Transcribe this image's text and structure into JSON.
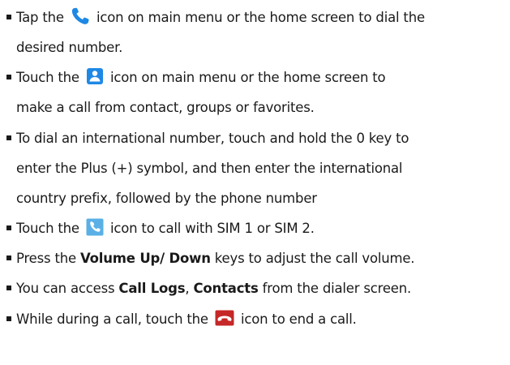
{
  "items": [
    {
      "line1_pre": "Tap the ",
      "line1_post": " icon on main menu or the home screen to dial the",
      "line2": "desired number."
    },
    {
      "line1_pre": "Touch the ",
      "line1_post": " icon on main menu or the home screen to",
      "line2": "make a call from contact, groups or favorites."
    },
    {
      "line1": "To dial an international number, touch and hold the 0 key to",
      "line2": "enter the Plus (+) symbol, and then enter the international",
      "line3": "country prefix, followed by the phone number"
    },
    {
      "line1_pre": "Touch the ",
      "line1_post": " icon to call with SIM 1 or SIM 2."
    },
    {
      "pre": "Press the ",
      "bold": "Volume Up/ Down",
      "post": " keys to adjust the call volume."
    },
    {
      "pre": "You can access ",
      "bold1": "Call Logs",
      "mid": ", ",
      "bold2": "Contacts",
      "post": " from the dialer screen."
    },
    {
      "line1_pre": "While during a call, touch the ",
      "line1_post": " icon to end a call."
    }
  ],
  "icons": {
    "phone_icon": "phone-icon",
    "contacts_icon": "contacts-icon",
    "sim_call_icon": "sim-call-icon",
    "end_call_icon": "end-call-icon"
  },
  "colors": {
    "phone_blue": "#1e88e5",
    "contacts_blue": "#1e88e5",
    "sim_call_bg": "#5ab0e6",
    "end_call_red": "#c62828"
  }
}
